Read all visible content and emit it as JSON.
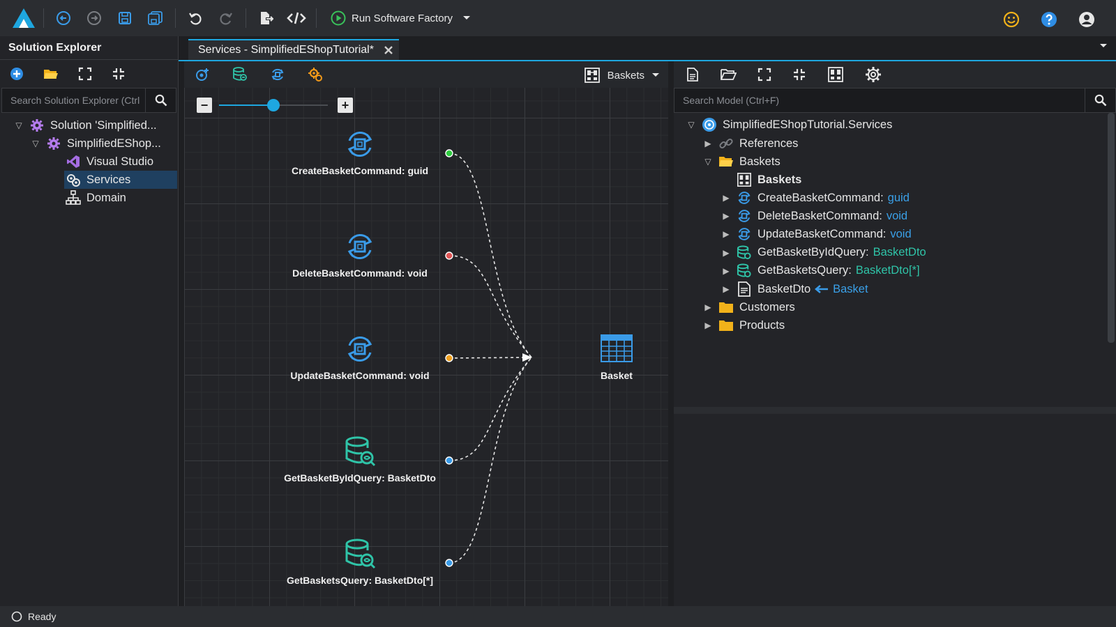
{
  "toolbar": {
    "run_label": "Run Software Factory"
  },
  "solution_explorer": {
    "title": "Solution Explorer",
    "search_placeholder": "Search Solution Explorer (Ctrl",
    "items": [
      {
        "label": "Solution 'Simplified...",
        "expanded": true
      },
      {
        "label": "SimplifiedEShop...",
        "expanded": true
      },
      {
        "label": "Visual Studio"
      },
      {
        "label": "Services",
        "selected": true
      },
      {
        "label": "Domain"
      }
    ]
  },
  "editor": {
    "tab_label": "Services - SimplifiedEShopTutorial*",
    "diagram_dropdown": "Baskets",
    "zoom_level": 0.5,
    "nodes": [
      {
        "label": "CreateBasketCommand: guid",
        "kind": "command",
        "dot": "#2ecc40"
      },
      {
        "label": "DeleteBasketCommand: void",
        "kind": "command",
        "dot": "#e05555"
      },
      {
        "label": "UpdateBasketCommand: void",
        "kind": "command",
        "dot": "#f0a020"
      },
      {
        "label": "GetBasketByIdQuery: BasketDto",
        "kind": "query",
        "dot": "#3a9be8"
      },
      {
        "label": "GetBasketsQuery: BasketDto[*]",
        "kind": "query",
        "dot": "#3a9be8"
      }
    ],
    "target": {
      "label": "Basket"
    }
  },
  "model_explorer": {
    "search_placeholder": "Search Model (Ctrl+F)",
    "root": "SimplifiedEShopTutorial.Services",
    "references": "References",
    "folder_baskets": "Baskets",
    "diagram_baskets": "Baskets",
    "items": [
      {
        "name": "CreateBasketCommand",
        "sep": ":",
        "type": "guid",
        "type_color": "blue",
        "kind": "command"
      },
      {
        "name": "DeleteBasketCommand",
        "sep": ":",
        "type": "void",
        "type_color": "blue",
        "kind": "command"
      },
      {
        "name": "UpdateBasketCommand",
        "sep": ":",
        "type": "void",
        "type_color": "blue",
        "kind": "command"
      },
      {
        "name": "GetBasketByIdQuery",
        "sep": ":",
        "type": "BasketDto",
        "type_color": "green",
        "kind": "query"
      },
      {
        "name": "GetBasketsQuery",
        "sep": ":",
        "type": "BasketDto[*]",
        "type_color": "green",
        "kind": "query"
      },
      {
        "name": "BasketDto",
        "sep": "",
        "type": "Basket",
        "type_color": "blue",
        "kind": "dto"
      }
    ],
    "folder_customers": "Customers",
    "folder_products": "Products"
  },
  "status": {
    "text": "Ready"
  },
  "colors": {
    "accent": "#1ea7e0",
    "command_icon": "#3a9be8",
    "query_icon": "#2fc4a8"
  }
}
